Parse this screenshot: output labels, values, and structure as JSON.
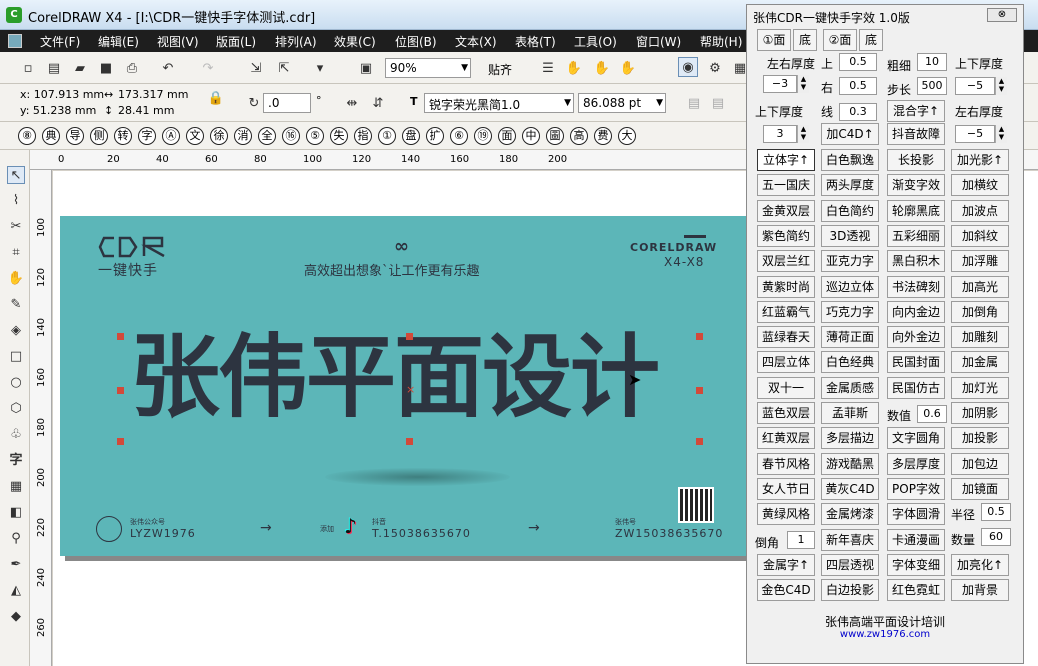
{
  "window": {
    "title": "CorelDRAW X4 - [I:\\CDR一键快手字体测试.cdr]",
    "app_icon": "coreldraw-icon"
  },
  "menu": [
    "文件(F)",
    "编辑(E)",
    "视图(V)",
    "版面(L)",
    "排列(A)",
    "效果(C)",
    "位图(B)",
    "文本(X)",
    "表格(T)",
    "工具(O)",
    "窗口(W)",
    "帮助(H)"
  ],
  "toolbar": {
    "zoom": "90%",
    "snap": "贴齐"
  },
  "propbar": {
    "x": "x:  107.913 mm",
    "y": "y:  51.238 mm",
    "w": "173.317 mm",
    "h": "28.41 mm",
    "angle": ".0",
    "angle_unit": "°",
    "font": "锐字荣光黑简1.0",
    "size": "86.088 pt"
  },
  "glyphs": [
    "⑧",
    "典",
    "导",
    "侧",
    "转",
    "字",
    "Ⓐ",
    "文",
    "徐",
    "消",
    "全",
    "⑯",
    "⑤",
    "失",
    "指",
    "①",
    "盘",
    "扩",
    "⑥",
    "⑲",
    "面",
    "中",
    "圖",
    "高",
    "费",
    "大"
  ],
  "ruler_top": [
    "0",
    "20",
    "40",
    "60",
    "80",
    "100",
    "120",
    "140",
    "160",
    "180",
    "200"
  ],
  "ruler_left": [
    "100",
    "120",
    "140",
    "160",
    "180",
    "200",
    "220",
    "240",
    "260"
  ],
  "design": {
    "logo_top": "CDR",
    "logo_sub": "一键快手",
    "slogan": "高效超出想象`让工作更有乐趣",
    "brand": "CORELDRAW",
    "version": "X4-X8",
    "headline": "张伟平面设计",
    "footer_account_label": "张伟公众号",
    "footer_account": "LYZW1976",
    "footer_douyin_label": "抖音",
    "footer_douyin": "T.15038635670",
    "footer_wechat_label": "张伟号",
    "footer_wechat": "ZW15038635670",
    "footer_prefix": "添加"
  },
  "panel": {
    "title": "张伟CDR一键快手字效 1.0版",
    "close": "⊗",
    "row1": [
      "①面",
      "底",
      "②面",
      "底"
    ],
    "lbl_lr": "左右厚度",
    "lbl_up": "上",
    "v_up": "0.5",
    "lbl_thin": "粗细",
    "v_thin": "10",
    "lbl_ud": "上下厚度",
    "v_lr": "−3",
    "lbl_right": "右",
    "v_right": "0.5",
    "lbl_step": "步长",
    "v_step": "500",
    "v_ud": "−5",
    "lbl_ud2": "上下厚度",
    "lbl_line": "线",
    "v_line": "0.3",
    "btn_mix": "混合字↑",
    "lbl_lr2": "左右厚度",
    "v_ud2": "3",
    "btn_c4d": "加C4D↑",
    "btn_glitch": "抖音故障",
    "v_lr2": "−5",
    "grid": [
      [
        "立体字↑",
        "白色飘逸",
        "长投影",
        "加光影↑"
      ],
      [
        "五一国庆",
        "两头厚度",
        "渐变字效",
        "加横纹"
      ],
      [
        "金黄双层",
        "白色简约",
        "轮廓黑底",
        "加波点"
      ],
      [
        "紫色简约",
        "3D透视",
        "五彩细丽",
        "加斜纹"
      ],
      [
        "双层兰红",
        "亚克力字",
        "黑白积木",
        "加浮雕"
      ],
      [
        "黄紫时尚",
        "巡边立体",
        "书法碑刻",
        "加高光"
      ],
      [
        "红蓝霸气",
        "巧克力字",
        "向内金边",
        "加倒角"
      ],
      [
        "蓝绿春天",
        "薄荷正面",
        "向外金边",
        "加雕刻"
      ],
      [
        "四层立体",
        "白色经典",
        "民国封面",
        "加金属"
      ],
      [
        "双十一",
        "金属质感",
        "民国仿古",
        "加灯光"
      ],
      [
        "蓝色双层",
        "孟菲斯",
        "",
        "加阴影"
      ],
      [
        "红黄双层",
        "多层描边",
        "文字圆角",
        "加投影"
      ],
      [
        "春节风格",
        "游戏酷黑",
        "多层厚度",
        "加包边"
      ],
      [
        "女人节日",
        "黄灰C4D",
        "POP字效",
        "加镜面"
      ],
      [
        "黄绿风格",
        "金属烤漆",
        "字体圆滑",
        ""
      ],
      [
        "",
        "新年喜庆",
        "卡通漫画",
        ""
      ],
      [
        "金属字↑",
        "四层透视",
        "字体变细",
        "加亮化↑"
      ],
      [
        "金色C4D",
        "白边投影",
        "红色霓虹",
        "加背景"
      ]
    ],
    "lbl_num": "数值",
    "v_num": "0.6",
    "lbl_radius": "半径",
    "v_radius": "0.5",
    "lbl_chamfer": "倒角",
    "v_chamfer": "1",
    "lbl_count": "数量",
    "v_count": "60",
    "footer": "张伟高端平面设计培训",
    "url": "www.zw1976.com"
  }
}
